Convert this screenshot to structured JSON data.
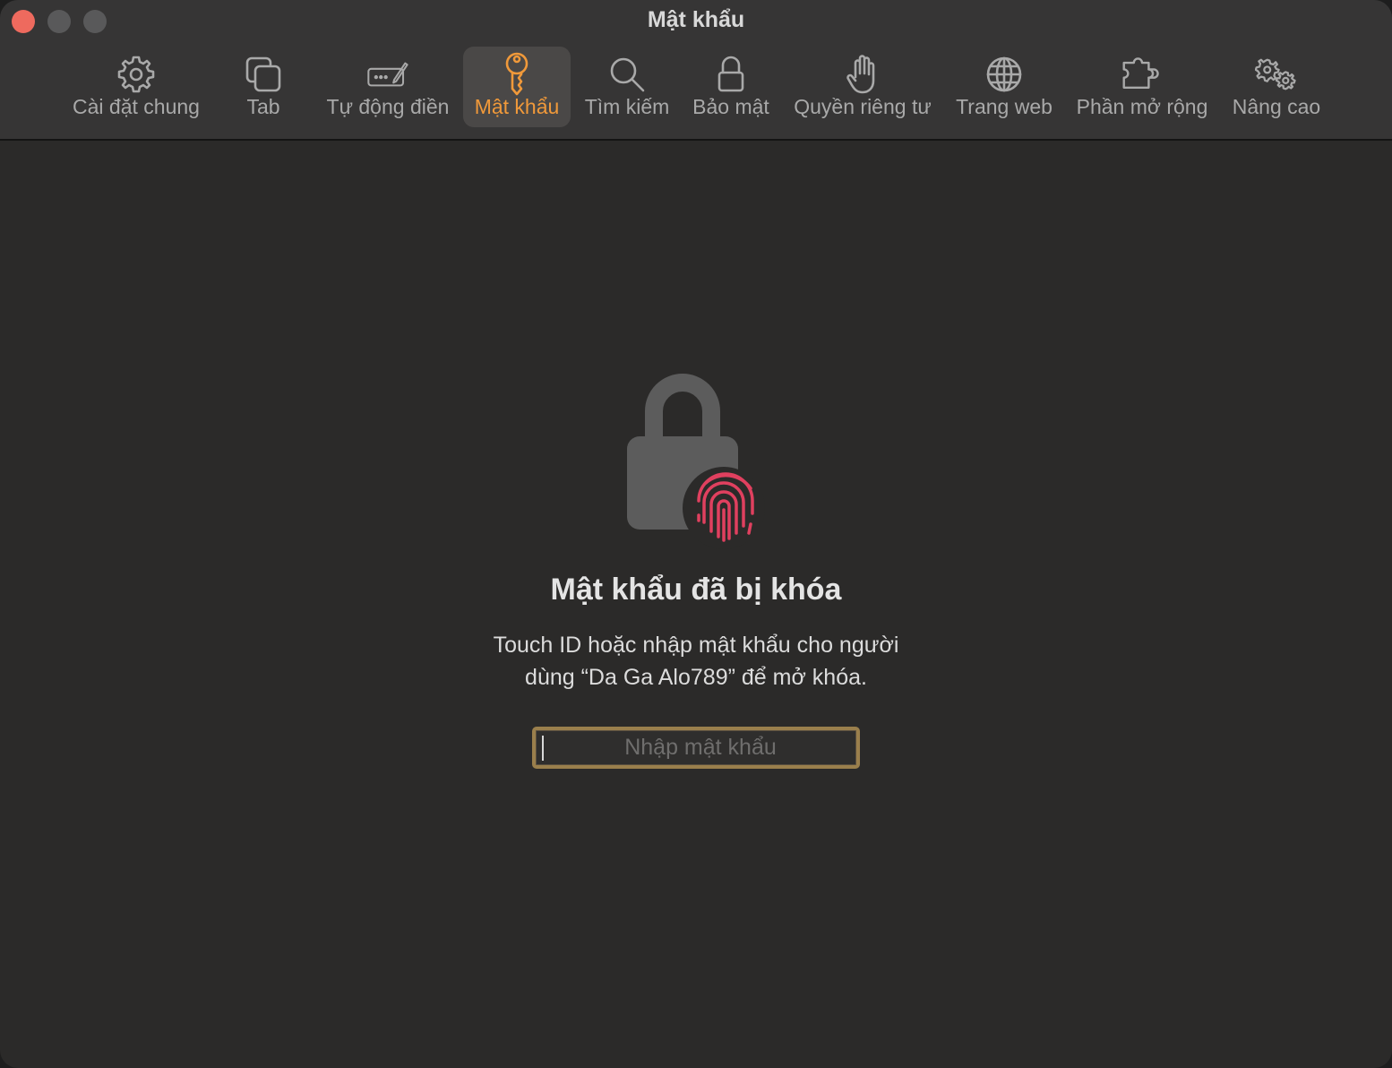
{
  "window": {
    "title": "Mật khẩu"
  },
  "toolbar": {
    "items": [
      {
        "label": "Cài đặt chung",
        "icon": "gear-icon"
      },
      {
        "label": "Tab",
        "icon": "tabs-icon"
      },
      {
        "label": "Tự động điền",
        "icon": "autofill-icon"
      },
      {
        "label": "Mật khẩu",
        "icon": "key-icon",
        "active": true
      },
      {
        "label": "Tìm kiếm",
        "icon": "search-icon"
      },
      {
        "label": "Bảo mật",
        "icon": "lock-icon"
      },
      {
        "label": "Quyền riêng tư",
        "icon": "hand-icon"
      },
      {
        "label": "Trang web",
        "icon": "globe-icon"
      },
      {
        "label": "Phần mở rộng",
        "icon": "extension-icon"
      },
      {
        "label": "Nâng cao",
        "icon": "advanced-gears-icon"
      }
    ]
  },
  "locked": {
    "title": "Mật khẩu đã bị khóa",
    "description_line1": "Touch ID hoặc nhập mật khẩu cho người",
    "description_line2": "dùng “Da Ga Alo789” để mở khóa.",
    "password_placeholder": "Nhập mật khẩu",
    "password_value": ""
  },
  "colors": {
    "accent": "#f0993a",
    "fingerprint": "#e0405f",
    "close_button": "#ee6a5e",
    "focus_ring": "#9a7f4c"
  }
}
